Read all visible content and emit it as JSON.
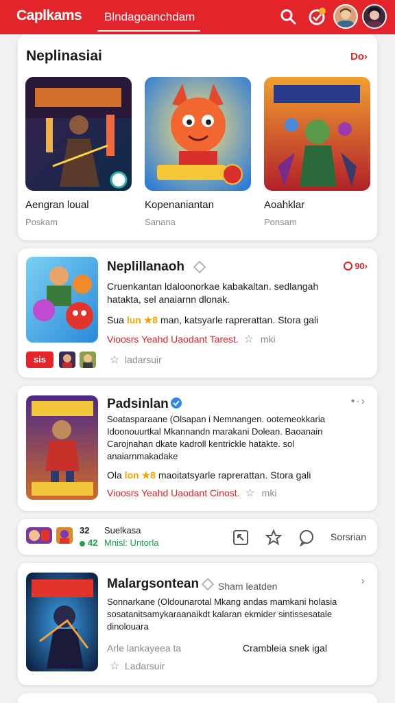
{
  "app": {
    "title": "Caplkams",
    "search_text": "Blndagoanchdam",
    "accent": "#e4242b"
  },
  "icons": {
    "search": "search-icon",
    "notification": "notification-icon",
    "avatar_1": "user-avatar",
    "avatar_2": "user-avatar"
  },
  "featured": {
    "title": "Neplinasiai",
    "more_label": "Do›",
    "items": [
      {
        "name": "Aengran loual",
        "sub": "Poskam"
      },
      {
        "name": "Kopenaniantan",
        "sub": "Sanana"
      },
      {
        "name": "Aoahklar",
        "sub": "Ponsam"
      }
    ]
  },
  "games": [
    {
      "title": "Neplillanaoh",
      "corner": "90›",
      "desc": "Cruenkantan ldaloonorkae kabakaltan. sedlangah hatakta, sel anaiarnn dlonak.",
      "stats_prefix": "Sua",
      "stats_gold": "lun ★8",
      "stats_rest": "man, katsyarle  raprerattan. Stora gali",
      "red_text": "Vioosrs Yeahd Uaodant Tarest.",
      "red_muted": "mki",
      "mini_label": "sis",
      "foot": "ladarsuir"
    },
    {
      "title": "Padsinlan",
      "desc": "Soatasparaane (Olsapan i Nemnangen. ootemeokkaria Idoonouurtkal Mkannandn marakani Dolean. Baoanain Carojnahan dkate kadroll kentrickle hatakte. sol anaiarnmakadake",
      "stats_prefix": "Ola",
      "stats_gold": "lon ★8",
      "stats_rest": "maoitatsyarle  raprerattan. Stora gali",
      "red_text": "Vioosrs Yeahd Uaodant Cinost.",
      "red_muted": "mki"
    }
  ],
  "action_bar": {
    "count_1": "32",
    "count_2": "42",
    "label_1": "Suelkasa",
    "label_2": "Mnisl: Untorla",
    "share": "Sorsrian"
  },
  "game3": {
    "title": "Malargsontean",
    "subtitle": "Sham leatden",
    "desc": "Sonnarkane (Oldounarotal Mkang andas mamkani holasia sosatanitsamykaraanaikdt kalaran ekmider sintissesatale dinolouara",
    "left_foot": "Arle lankayeea ta",
    "right_foot": "Crambleia snek igal",
    "foot": "Ladarsuir"
  }
}
